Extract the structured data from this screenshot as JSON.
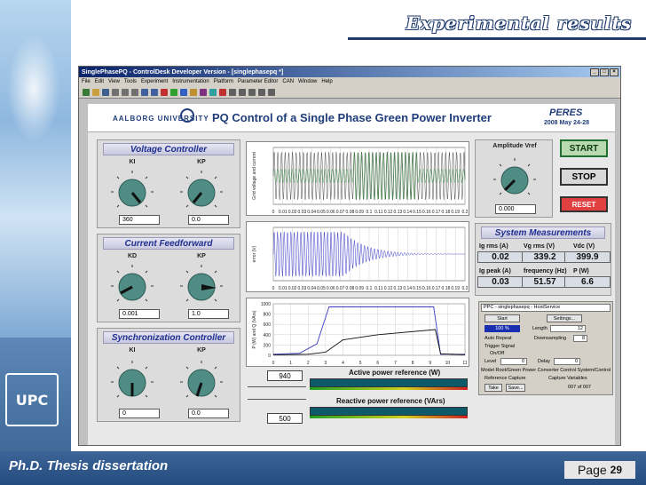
{
  "slide": {
    "title": "Experimental results",
    "footer_left": "Ph.D.  Thesis dissertation",
    "page_label": "Page",
    "page_number": "29",
    "logo_text": "UPC"
  },
  "window": {
    "title": "SinglePhasePQ - ControlDesk Developer Version - [singlephasepq *]",
    "menu": [
      "File",
      "Edit",
      "View",
      "Tools",
      "Experiment",
      "Instrumentation",
      "Platform",
      "Parameter Editor",
      "CAN",
      "Window",
      "Help"
    ],
    "buttons": {
      "minimize": "_",
      "maximize": "□",
      "close": "×"
    }
  },
  "header": {
    "university": "AALBORG UNIVERSITY",
    "main_title": "PQ Control of a Single Phase Green Power Inverter",
    "peres": "PERES",
    "date": "2008 May 24-28"
  },
  "voltage_controller": {
    "title": "Voltage Controller",
    "ki_label": "KI",
    "kp_label": "KP",
    "ki_value": "360",
    "kp_value": "0.0"
  },
  "current_feedforward": {
    "title": "Current Feedforward",
    "kd_label": "KD",
    "kp_label": "KP",
    "kd_value": "0.001",
    "kp_value": "1.0"
  },
  "sync_controller": {
    "title": "Synchronization Controller",
    "ki_label": "KI",
    "kp_label": "KP",
    "ki_value": "0",
    "kp_value": "0.0"
  },
  "amplitude": {
    "label": "Amplitude Vref",
    "value": "0.000"
  },
  "buttons": {
    "start": "START",
    "stop": "STOP",
    "reset": "RESET"
  },
  "system_measurements": {
    "title": "System Measurements",
    "items": [
      {
        "label": "Ig rms (A)",
        "value": "0.02"
      },
      {
        "label": "Vg rms (V)",
        "value": "339.2"
      },
      {
        "label": "Vdc (V)",
        "value": "399.9"
      },
      {
        "label": "Ig peak (A)",
        "value": "0.03"
      },
      {
        "label": "frequency (Hz)",
        "value": "51.57"
      },
      {
        "label": "P (W)",
        "value": "6.6"
      }
    ]
  },
  "host_panel": {
    "title": "PPC - singlephasepq - HostService",
    "start": "Start",
    "settings": "Settings...",
    "progress": "100 %",
    "length_label": "Length",
    "length_value": "12",
    "auto_repeat": "Auto Repeat",
    "downsampling": "Downsampling",
    "downsampling_value": "8",
    "trigger_signal": "Trigger Signal",
    "on_off": "On/Off",
    "level_label": "Level",
    "level_value": "0",
    "delay_label": "Delay",
    "delay_value": "0",
    "model_path": "Model Root/Green Power Converter Control System/Control/D",
    "reference_capture": "Reference Capture",
    "capture_variables": "Capture Variables",
    "take": "Take",
    "save": "Save...",
    "count": "007 of 007"
  },
  "references": {
    "active_label": "Active power reference  (W)",
    "active_value": "940",
    "reactive_label": "Reactive power reference  (VArs)",
    "reactive_value": "500"
  },
  "chart_data": [
    {
      "type": "line",
      "title": "",
      "ylabel": "Grid voltage and current",
      "x": [
        0,
        0.01,
        0.02,
        0.03,
        0.04,
        0.05,
        0.06,
        0.07,
        0.08,
        0.09,
        0.1,
        0.11,
        0.12,
        0.13,
        0.14,
        0.15,
        0.16,
        0.17,
        0.18,
        0.19,
        0.2
      ],
      "ylim": [
        -400,
        400
      ],
      "series": []
    },
    {
      "type": "line",
      "title": "",
      "ylabel": "error (V)",
      "x": [
        0,
        0.01,
        0.02,
        0.03,
        0.04,
        0.05,
        0.06,
        0.07,
        0.08,
        0.09,
        0.1,
        0.11,
        0.12,
        0.13,
        0.14,
        0.15,
        0.16,
        0.17,
        0.18,
        0.19,
        0.2
      ],
      "ylim": [
        -100,
        100
      ],
      "series": []
    },
    {
      "type": "line",
      "title": "",
      "ylabel": "P (W) and Q (VArs)",
      "x": [
        0,
        1,
        2,
        3,
        4,
        5,
        6,
        7,
        8,
        9,
        10,
        11
      ],
      "ylim": [
        0,
        1000
      ],
      "yticks": [
        0,
        200,
        400,
        600,
        800,
        1000
      ],
      "series": []
    }
  ]
}
